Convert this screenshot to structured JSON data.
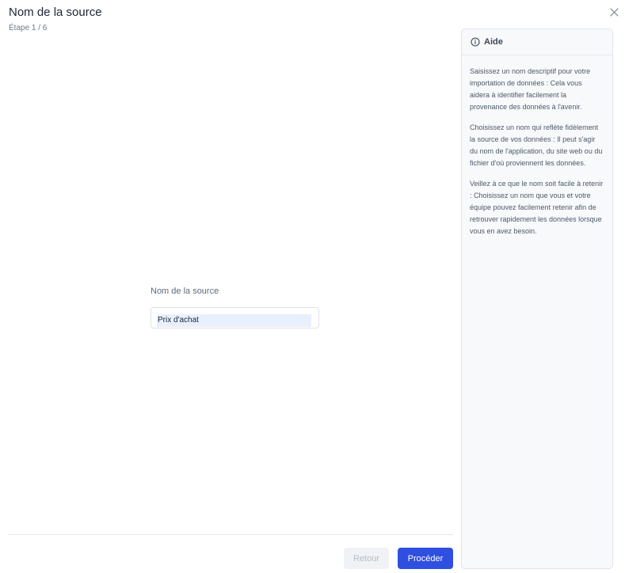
{
  "modal": {
    "title": "Nom de la source",
    "step": "Étape 1 / 6"
  },
  "help": {
    "title": "Aide",
    "icon": "info-circle-icon",
    "paragraphs": [
      "Saisissez un nom descriptif pour votre importation de données : Cela vous aidera à identifier facilement la provenance des données à l'avenir.",
      "Choisissez un nom qui reflète fidèlement la source de vos données : Il peut s'agir du nom de l'application, du site web ou du fichier d'où proviennent les données.",
      "Veillez à ce que le nom soit facile à retenir : Choisissez un nom que vous et votre équipe pouvez facilement retenir afin de retrouver rapidement les données lorsque vous en avez besoin."
    ]
  },
  "form": {
    "label": "Nom de la source",
    "value": "Prix d'achat"
  },
  "actions": {
    "back_label": "Retour",
    "next_label": "Procéder"
  },
  "colors": {
    "primary": "#2f4fe0",
    "disabled_bg": "#f0f2f5",
    "autofill_bg": "#e8f0fe"
  }
}
